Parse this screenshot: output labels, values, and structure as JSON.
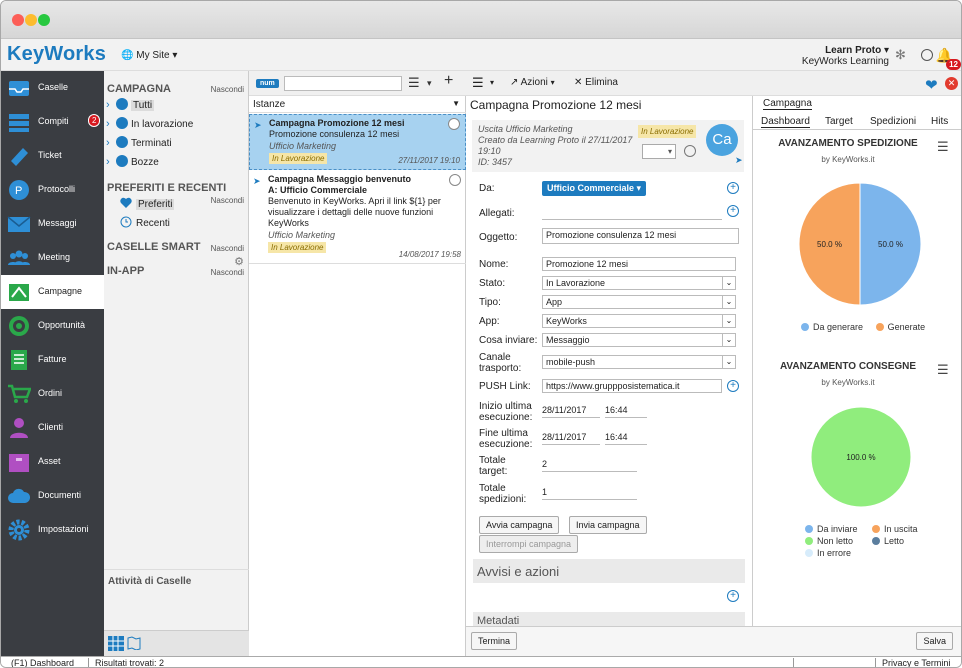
{
  "app": {
    "name": "KeyWorks",
    "site": "My Site"
  },
  "user": {
    "name": "Learn Proto",
    "org": "KeyWorks Learning",
    "notifications": "12"
  },
  "sidebar": {
    "items": [
      {
        "label": "Caselle",
        "icon": "inbox-icon"
      },
      {
        "label": "Compiti",
        "icon": "tasks-icon",
        "badge": "2"
      },
      {
        "label": "Ticket",
        "icon": "ticket-icon"
      },
      {
        "label": "Protocolli",
        "icon": "protocol-icon"
      },
      {
        "label": "Messaggi",
        "icon": "envelope-icon"
      },
      {
        "label": "Meeting",
        "icon": "meeting-icon"
      },
      {
        "label": "Campagne",
        "icon": "campaign-icon"
      },
      {
        "label": "Opportunità",
        "icon": "target-icon"
      },
      {
        "label": "Fatture",
        "icon": "invoice-icon"
      },
      {
        "label": "Ordini",
        "icon": "cart-icon"
      },
      {
        "label": "Clienti",
        "icon": "person-icon"
      },
      {
        "label": "Asset",
        "icon": "asset-icon"
      },
      {
        "label": "Documenti",
        "icon": "cloud-icon"
      },
      {
        "label": "Impostazioni",
        "icon": "gear-icon"
      }
    ],
    "active": "Campagne"
  },
  "folders": {
    "campagna_title": "CAMPAGNA",
    "hide": "Nascondi",
    "campagna_items": [
      "Tutti",
      "In lavorazione",
      "Terminati",
      "Bozze"
    ],
    "preferiti_title": "PREFERITI E RECENTI",
    "preferiti_items": [
      "Preferiti",
      "Recenti"
    ],
    "smart_title": "CASELLE SMART",
    "inapp_title": "IN-APP",
    "attivita": "Attività di Caselle"
  },
  "list": {
    "tag": "num",
    "search_value": "",
    "filter": "Istanze",
    "messages": [
      {
        "subject": "Campagna Promozione 12 mesi",
        "body": "Promozione consulenza 12 mesi",
        "from": "Ufficio Marketing",
        "status": "In Lavorazione",
        "date": "27/11/2017 19:10"
      },
      {
        "subject": "Campagna Messaggio benvenuto",
        "subject2": "A: Ufficio Commerciale",
        "body": "Benvenuto in KeyWorks. Apri il link ${1} per visualizzare i dettagli delle nuove funzioni KeyWorks",
        "from": "Ufficio Marketing",
        "status": "In Lavorazione",
        "date": "14/08/2017 19:58"
      }
    ]
  },
  "detail": {
    "toolbar": {
      "actions": "Azioni",
      "delete": "Elimina"
    },
    "title": "Campagna Promozione 12 mesi",
    "header": {
      "line1": "Uscita Ufficio Marketing",
      "line2": "Creato da Learning Proto il 27/11/2017",
      "line3": "19:10",
      "line4": "ID: 3457",
      "status": "In Lavorazione",
      "avatar": "Ca"
    },
    "fields": {
      "da_label": "Da:",
      "da_value": "Ufficio Commerciale",
      "allegati_label": "Allegati:",
      "oggetto_label": "Oggetto:",
      "oggetto_value": "Promozione consulenza 12 mesi",
      "nome_label": "Nome:",
      "nome_value": "Promozione 12 mesi",
      "stato_label": "Stato:",
      "stato_value": "In Lavorazione",
      "tipo_label": "Tipo:",
      "tipo_value": "App",
      "app_label": "App:",
      "app_value": "KeyWorks",
      "cosa_label": "Cosa inviare:",
      "cosa_value": "Messaggio",
      "canale_label1": "Canale",
      "canale_label2": "trasporto:",
      "canale_value": "mobile-push",
      "push_label": "PUSH Link:",
      "push_value": "https://www.gruppposistematica.it",
      "inizio_label1": "Inizio ultima",
      "inizio_label2": "esecuzione:",
      "inizio_date": "28/11/2017",
      "inizio_time": "16:44",
      "fine_label1": "Fine ultima",
      "fine_label2": "esecuzione:",
      "fine_date": "28/11/2017",
      "fine_time": "16:44",
      "target_label1": "Totale",
      "target_label2": "target:",
      "target_value": "2",
      "sped_label1": "Totale",
      "sped_label2": "spedizioni:",
      "sped_value": "1"
    },
    "buttons": {
      "avvia": "Avvia campagna",
      "invia": "Invia campagna",
      "interrompi": "Interrompi campagna"
    },
    "sections": {
      "avvisi": "Avvisi e azioni",
      "metadati": "Metadati"
    },
    "termina": "Termina"
  },
  "dashboard": {
    "top_tab": "Campagna",
    "tabs": [
      "Dashboard",
      "Target",
      "Spedizioni",
      "Hits"
    ],
    "chart1": {
      "title": "AVANZAMENTO SPEDIZIONE",
      "subtitle": "by KeyWorks.it",
      "label_a": "50.0 %",
      "label_b": "50.0 %"
    },
    "chart2": {
      "title": "AVANZAMENTO CONSEGNE",
      "subtitle": "by KeyWorks.it",
      "label_a": "100.0 %"
    },
    "save": "Salva"
  },
  "chart_data": [
    {
      "type": "pie",
      "title": "AVANZAMENTO SPEDIZIONE",
      "categories": [
        "Da generare",
        "Generate"
      ],
      "values": [
        50.0,
        50.0
      ],
      "colors": [
        "#7cb5ec",
        "#f7a35c"
      ]
    },
    {
      "type": "pie",
      "title": "AVANZAMENTO CONSEGNE",
      "categories": [
        "Da inviare",
        "In uscita",
        "Non letto",
        "Letto",
        "In errore"
      ],
      "values": [
        0,
        0,
        100.0,
        0,
        0
      ],
      "colors": [
        "#7cb5ec",
        "#f7a35c",
        "#90ed7d",
        "#5b7e9e",
        "#d7ecfb"
      ]
    }
  ],
  "statusbar": {
    "left": "(F1) Dashboard",
    "results": "Risultati trovati: 2",
    "right": "Privacy e Termini"
  }
}
